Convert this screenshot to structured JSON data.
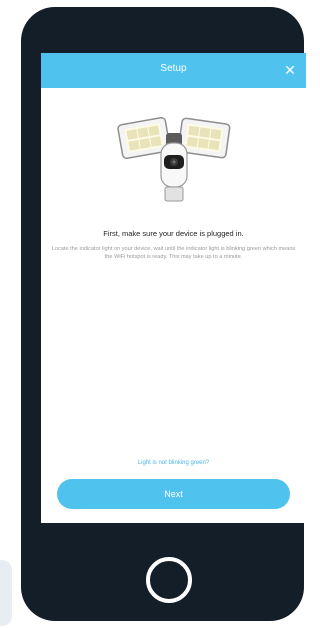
{
  "header": {
    "title": "Setup",
    "close_icon": "close-icon",
    "close_glyph": "✕"
  },
  "content": {
    "device_image": "floodlight-camera",
    "headline": "First, make sure your device is plugged in.",
    "description": "Locate the indicator light on your device, wait until the indicator light is blinking green which means the WiFi hotspot is ready. This may take up to a minute."
  },
  "footer": {
    "help_link": "Light is not blinking green?",
    "next_label": "Next"
  },
  "colors": {
    "accent": "#4fc3ee",
    "phone_body": "#141e28",
    "link": "#4fb3e6"
  }
}
